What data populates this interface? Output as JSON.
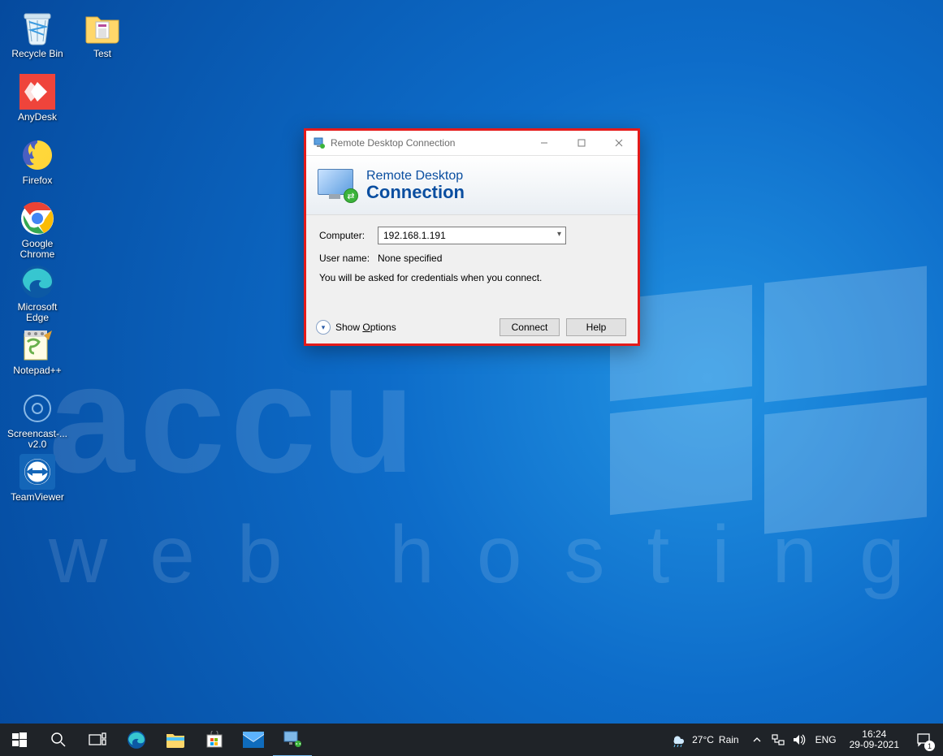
{
  "desktop_icons": [
    {
      "label": "Recycle Bin"
    },
    {
      "label": "AnyDesk"
    },
    {
      "label": "Firefox"
    },
    {
      "label": "Google Chrome"
    },
    {
      "label": "Microsoft Edge"
    },
    {
      "label": "Notepad++"
    },
    {
      "label": "Screencast-... v2.0"
    },
    {
      "label": "TeamViewer"
    }
  ],
  "extra_icon": {
    "label": "Test"
  },
  "rdc": {
    "title": "Remote Desktop Connection",
    "heading_l1": "Remote Desktop",
    "heading_l2": "Connection",
    "computer_label": "Computer:",
    "computer_value": "192.168.1.191",
    "username_label": "User name:",
    "username_value": "None specified",
    "hint": "You will be asked for credentials when you connect.",
    "show_options_prefix": "Show ",
    "show_options_u": "O",
    "show_options_suffix": "ptions",
    "connect": "Connect",
    "help": "Help"
  },
  "tray": {
    "weather_temp": "27°C",
    "weather_desc": "Rain",
    "lang": "ENG",
    "time": "16:24",
    "date": "29-09-2021",
    "notif_count": "1"
  },
  "watermark": {
    "l1": "accu",
    "l2": "web hosting"
  }
}
